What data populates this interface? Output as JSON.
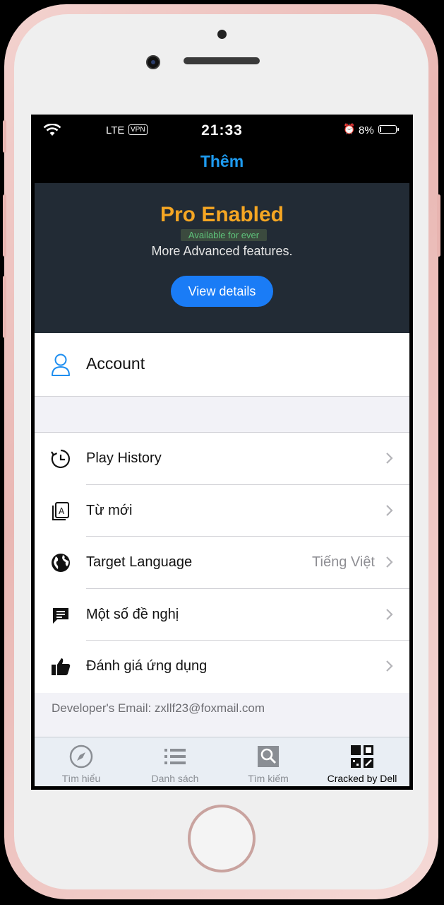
{
  "status_bar": {
    "carrier_signal": "wifi-icon",
    "network": "LTE",
    "vpn": "VPN",
    "time": "21:33",
    "alarm_icon": "alarm-icon",
    "battery_percent_text": "8%",
    "battery_level": 0.08
  },
  "navbar": {
    "title": "Thêm"
  },
  "promo": {
    "title": "Pro Enabled",
    "badge": "Available for ever",
    "subtitle": "More Advanced features.",
    "button": "View details",
    "colors": {
      "title": "#f5a623",
      "badge": "#5ec27a",
      "button": "#1a7cf6",
      "background": "#222b35"
    }
  },
  "account": {
    "label": "Account",
    "icon": "user-icon"
  },
  "menu": [
    {
      "label": "Play History",
      "icon": "history-clock-icon",
      "value": ""
    },
    {
      "label": "Từ mới",
      "icon": "new-words-icon",
      "value": ""
    },
    {
      "label": "Target Language",
      "icon": "globe-icon",
      "value": "Tiếng Việt"
    },
    {
      "label": "Một số đề nghị",
      "icon": "feedback-icon",
      "value": ""
    },
    {
      "label": "Đánh giá ứng dụng",
      "icon": "thumbs-up-icon",
      "value": ""
    }
  ],
  "footer": {
    "developer_email": "Developer's Email: zxllf23@foxmail.com"
  },
  "tabs": [
    {
      "label": "Tìm hiểu",
      "icon": "compass-icon",
      "active": false
    },
    {
      "label": "Danh sách",
      "icon": "list-icon",
      "active": false
    },
    {
      "label": "Tìm kiếm",
      "icon": "search-icon",
      "active": false
    },
    {
      "label": "Cracked by Dell",
      "icon": "qr-grid-icon",
      "active": true
    }
  ],
  "accent_color": "#1e9bf0"
}
